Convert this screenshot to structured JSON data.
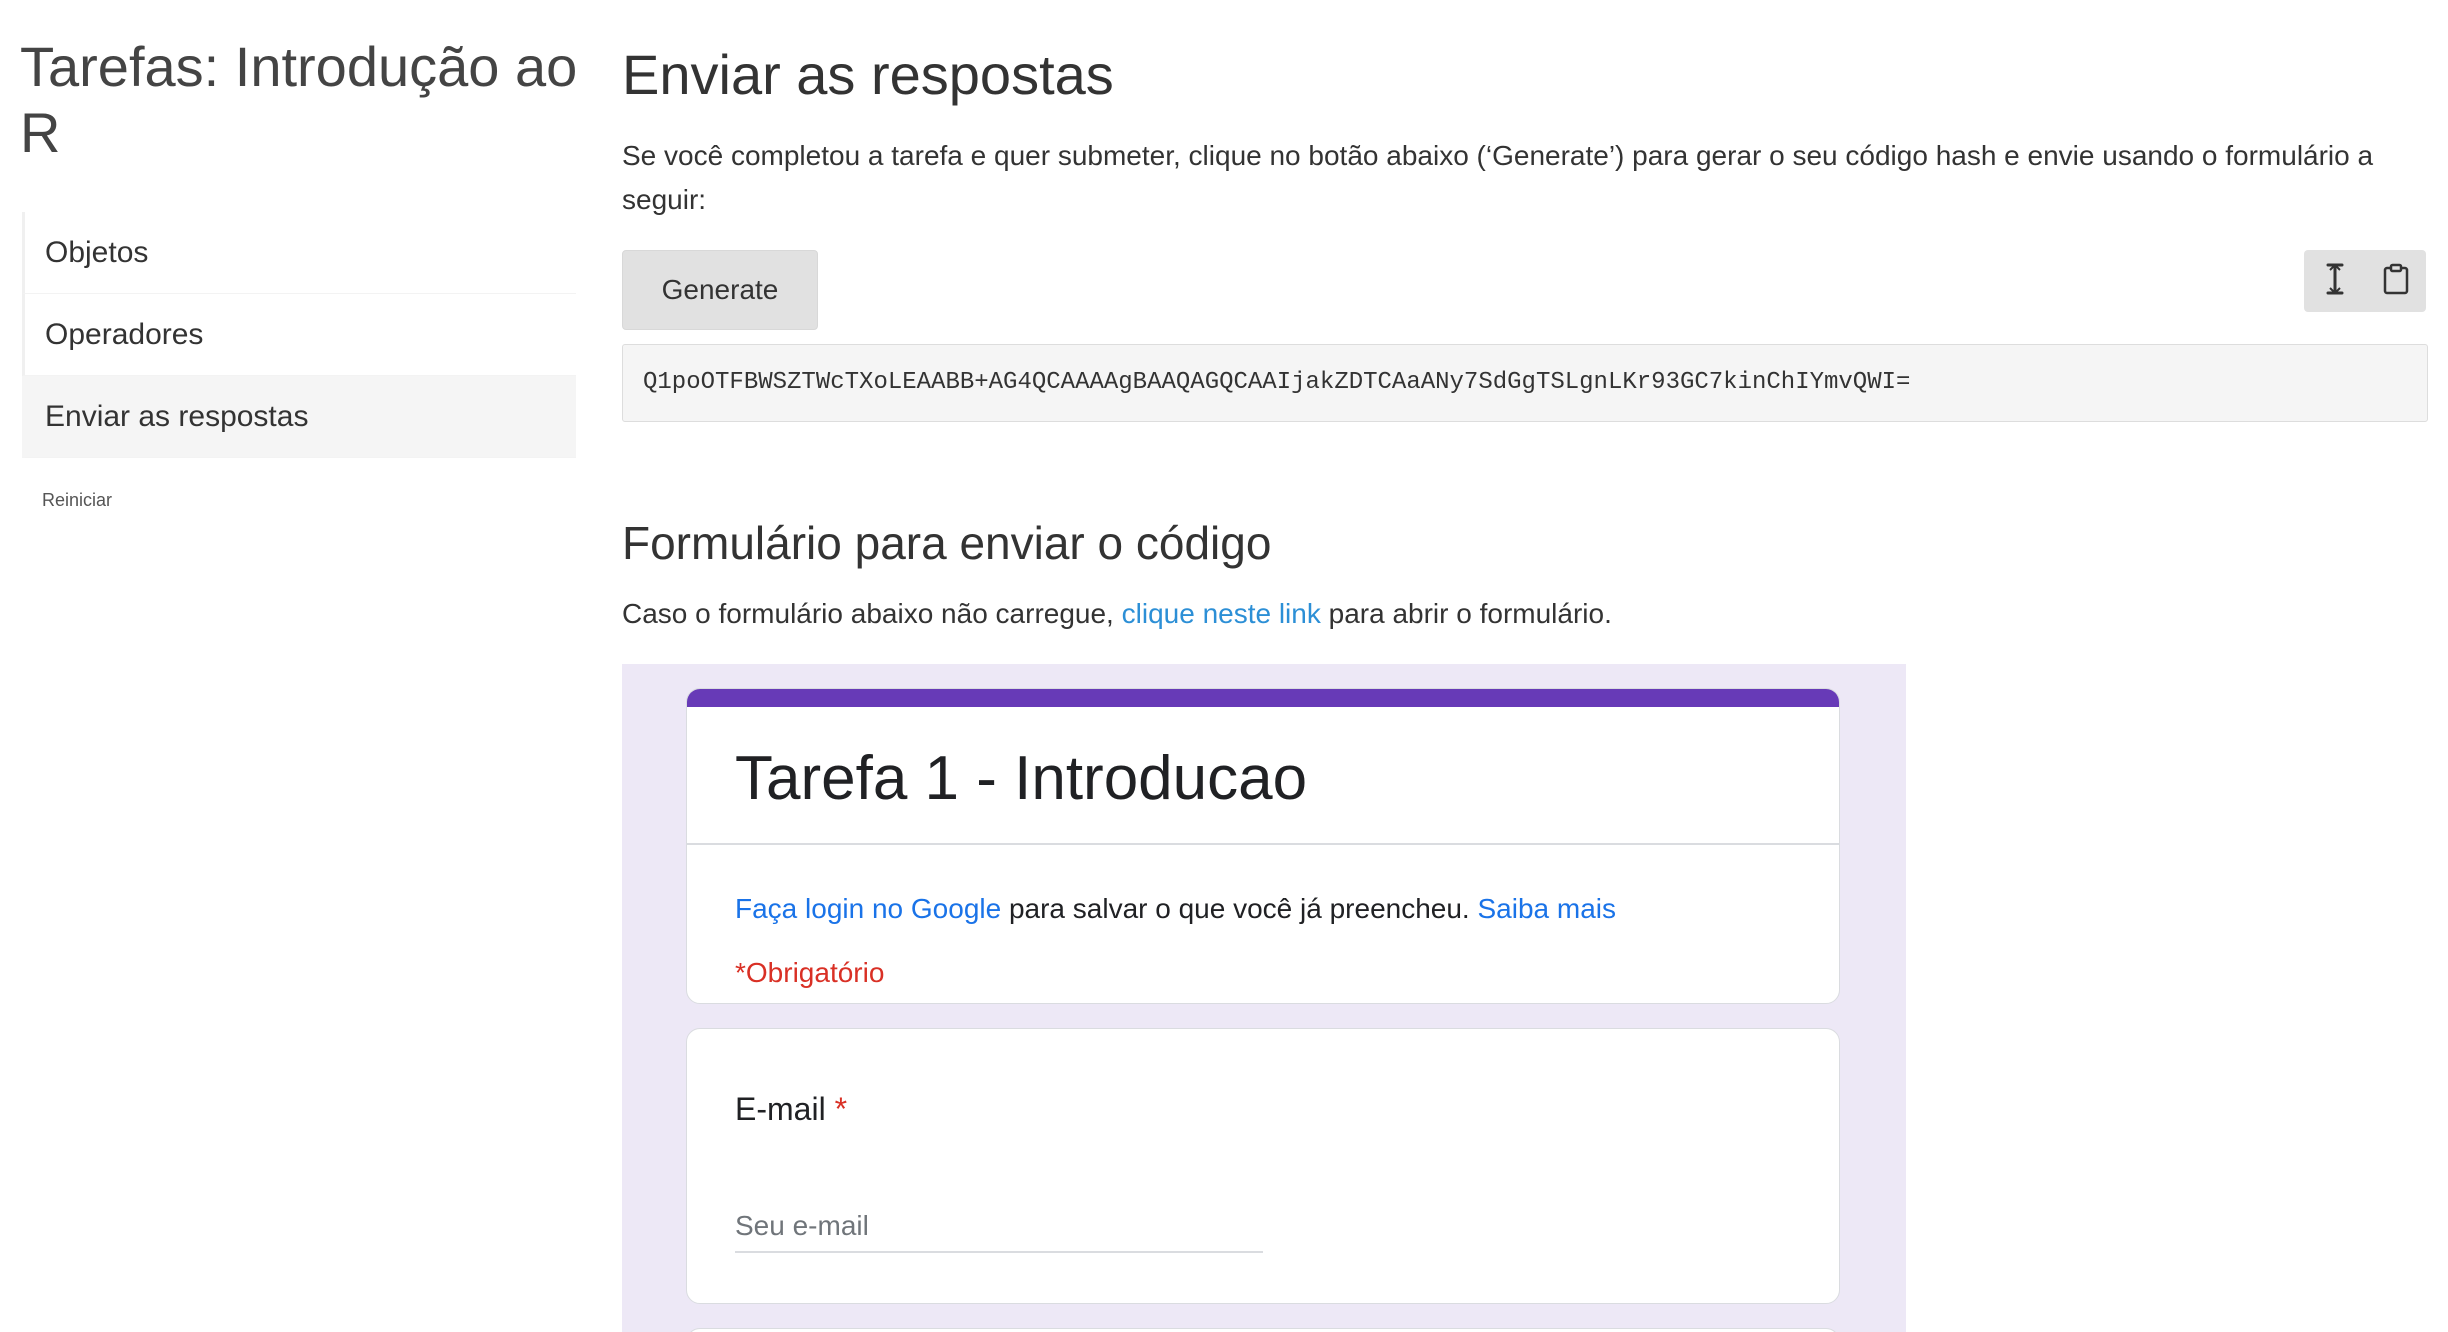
{
  "sidebar": {
    "title": "Tarefas: Introdução ao R",
    "items": [
      {
        "label": "Objetos"
      },
      {
        "label": "Operadores"
      },
      {
        "label": "Enviar as respostas"
      }
    ],
    "reset_label": "Reiniciar"
  },
  "main": {
    "section_title": "Enviar as respostas",
    "intro": "Se você completou a tarefa e quer submeter, clique no botão abaixo (‘Generate’) para gerar o seu código hash e envie usando o formulário a seguir:",
    "generate_label": "Generate",
    "tools": {
      "select_icon": "text-cursor-icon",
      "copy_icon": "clipboard-icon"
    },
    "hash": "Q1poOTFBWSZTWcTXoLEAABB+AG4QCAAAAgBAAQAGQCAAIjakZDTCAaANy7SdGgTSLgnLKr93GC7kinChIYmvQWI=",
    "form_section_title": "Formulário para enviar o código",
    "form_note_before": "Caso o formulário abaixo não carregue, ",
    "form_note_link": "clique neste link",
    "form_note_after": " para abrir o formulário."
  },
  "gform": {
    "title": "Tarefa 1 - Introducao",
    "login_link": "Faça login no Google",
    "login_text": " para salvar o que você já preencheu. ",
    "learn_more": "Saiba mais",
    "required_note": "*Obrigatório",
    "email_label": "E-mail",
    "required_star": "*",
    "email_placeholder": "Seu e-mail"
  },
  "colors": {
    "accent_purple": "#673ab7",
    "form_background": "#ede8f6",
    "link_blue": "#2c8fd6",
    "google_blue": "#1a73e8",
    "required_red": "#d93025"
  }
}
